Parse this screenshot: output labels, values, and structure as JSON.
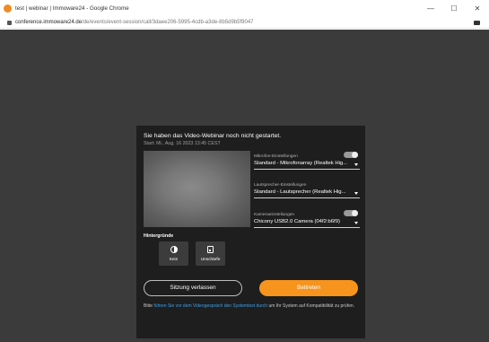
{
  "window": {
    "title": "test | webinar | Immoware24 - Google Chrome",
    "controls": {
      "minimize": "—",
      "maximize": "☐",
      "close": "✕"
    }
  },
  "address_bar": {
    "host": "conference.immoware24.de",
    "path": "/de/events/event-session/call/3daee206-5995-4cdb-a3de-8b5d9b5f9047"
  },
  "dialog": {
    "title": "Sie haben das Video-Webinar noch nicht gestartet.",
    "start": "Start: Mi., Aug. 16 2023 13:45 CEST",
    "mic": {
      "label": "Mikrofon-Einstellungen",
      "value": "Standard - Mikrofonarray (Realtek Hig...",
      "enabled": true
    },
    "speaker": {
      "label": "Lautsprecher-Einstellungen",
      "value": "Standard - Lautsprecher (Realtek Hig..."
    },
    "camera": {
      "label": "Kameraeinstellungen",
      "value": "Chicony USB2.0 Camera (04f2:b6f9)",
      "enabled": true
    },
    "backgrounds": {
      "label": "Hintergründe",
      "options": [
        {
          "label": "Kein",
          "icon": "no-background-icon"
        },
        {
          "label": "Unschärfe",
          "icon": "blur-icon"
        }
      ]
    },
    "leave_button": "Sitzung verlassen",
    "join_button": "Beitreten",
    "note_before": "Bitte ",
    "note_link": "führen Sie vor dem Videogespräch den Systemtest durch",
    "note_after": " um Ihr System auf Kompatibilität zu prüfen."
  },
  "colors": {
    "accent": "#f7941d",
    "link": "#3ba0e6",
    "dialog_bg": "#1e1e1e",
    "page_bg": "#3b3b3b"
  }
}
